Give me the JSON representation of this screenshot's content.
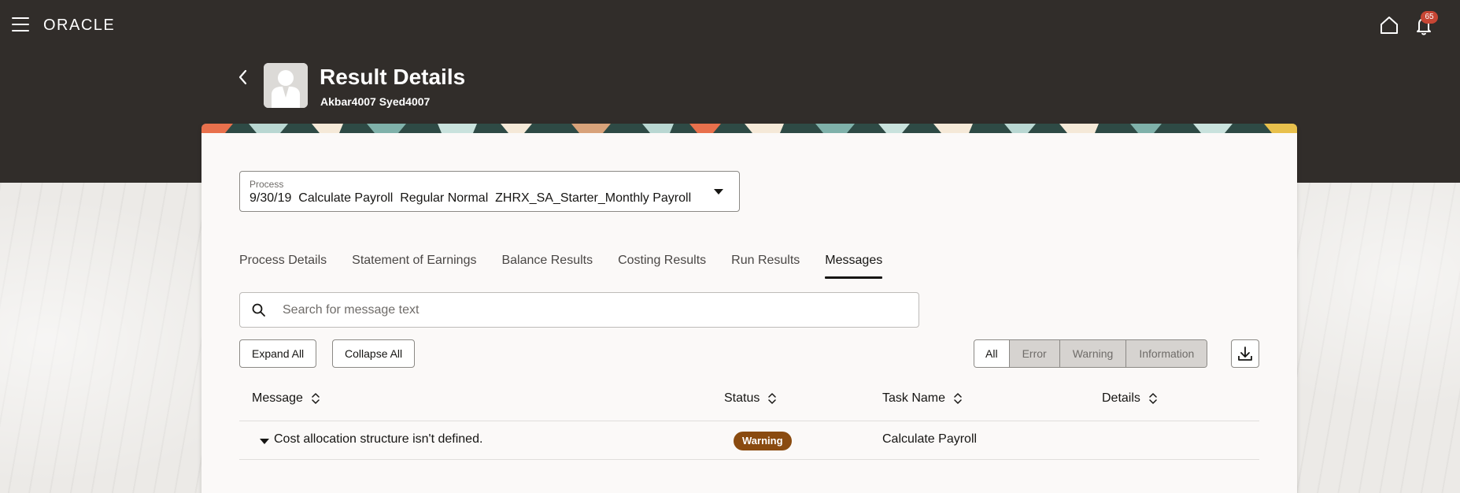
{
  "header": {
    "brand": "ORACLE",
    "notification_count": "65"
  },
  "page": {
    "title": "Result Details",
    "subtitle": "Akbar4007 Syed4007"
  },
  "process": {
    "label": "Process",
    "value": "9/30/19  Calculate Payroll  Regular Normal  ZHRX_SA_Starter_Monthly Payroll"
  },
  "tabs": [
    {
      "label": "Process Details",
      "active": false
    },
    {
      "label": "Statement of Earnings",
      "active": false
    },
    {
      "label": "Balance Results",
      "active": false
    },
    {
      "label": "Costing Results",
      "active": false
    },
    {
      "label": "Run Results",
      "active": false
    },
    {
      "label": "Messages",
      "active": true
    }
  ],
  "search": {
    "placeholder": "Search for message text",
    "value": ""
  },
  "actions": {
    "expand_all": "Expand All",
    "collapse_all": "Collapse All"
  },
  "filters": [
    "All",
    "Error",
    "Warning",
    "Information"
  ],
  "selected_filter": "All",
  "table": {
    "columns": [
      "Message",
      "Status",
      "Task Name",
      "Details"
    ],
    "rows": [
      {
        "message": "Cost allocation structure isn't defined.",
        "status": "Warning",
        "task_name": "Calculate Payroll",
        "details": ""
      }
    ]
  },
  "colors": {
    "header_bg": "#312d2a",
    "warning_badge": "#8a4b10",
    "notification_badge": "#c74634"
  },
  "icons": [
    "menu-icon",
    "home-icon",
    "bell-icon",
    "back-arrow-icon",
    "avatar-placeholder-icon",
    "search-icon",
    "download-icon",
    "sort-icon",
    "caret-down-icon"
  ]
}
